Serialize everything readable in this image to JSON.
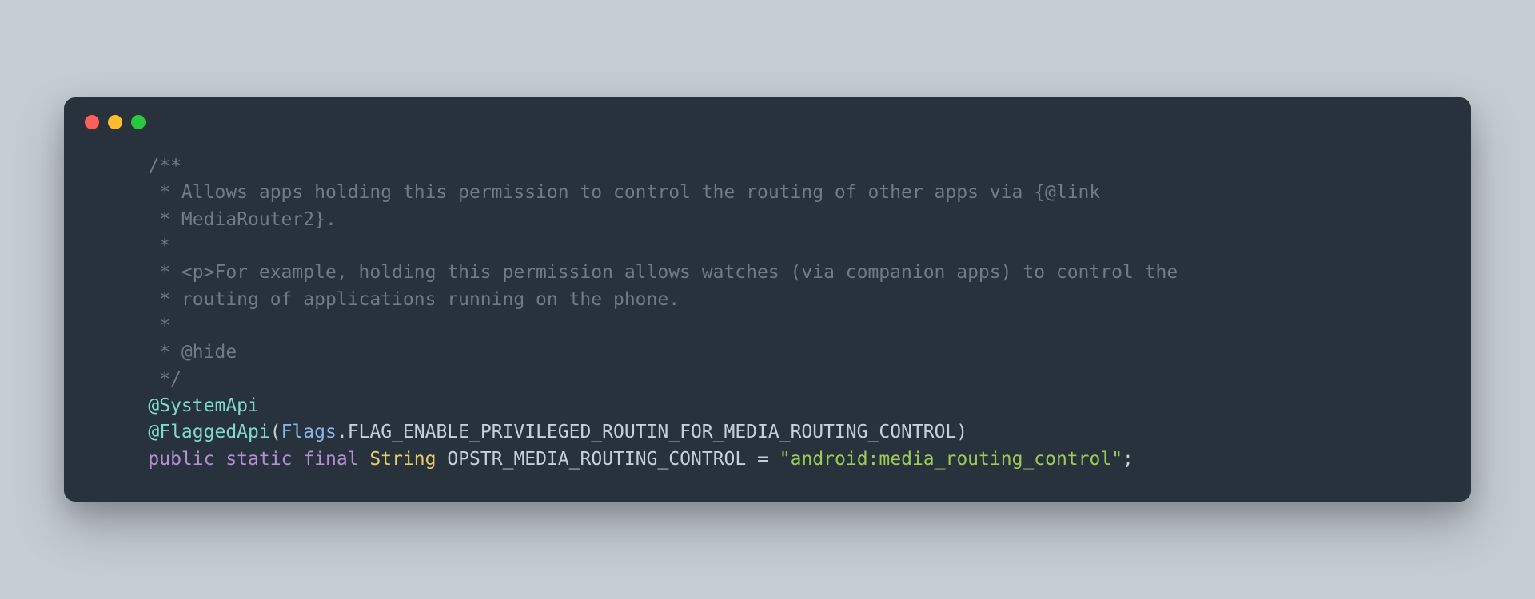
{
  "window": {
    "traffic_lights": [
      "close",
      "minimize",
      "zoom"
    ]
  },
  "code": {
    "c1": "    /**",
    "c2": "     * Allows apps holding this permission to control the routing of other apps via {@link",
    "c3": "     * MediaRouter2}.",
    "c4": "     *",
    "c5": "     * <p>For example, holding this permission allows watches (via companion apps) to control the",
    "c6": "     * routing of applications running on the phone.",
    "c7": "     *",
    "c8": "     * @hide",
    "c9": "     */",
    "indent": "    ",
    "ann1": "@SystemApi",
    "ann2": "@FlaggedApi",
    "lp": "(",
    "flags_class": "Flags",
    "dotop": ".",
    "flag_const": "FLAG_ENABLE_PRIVILEGED_ROUTIN_FOR_MEDIA_ROUTING_CONTROL",
    "rp": ")",
    "kw_public": "public",
    "kw_static": "static",
    "kw_final": "final",
    "type_string": "String",
    "var_name": "OPSTR_MEDIA_ROUTING_CONTROL",
    "eq": " = ",
    "str_val": "\"android:media_routing_control\"",
    "semi": ";"
  }
}
